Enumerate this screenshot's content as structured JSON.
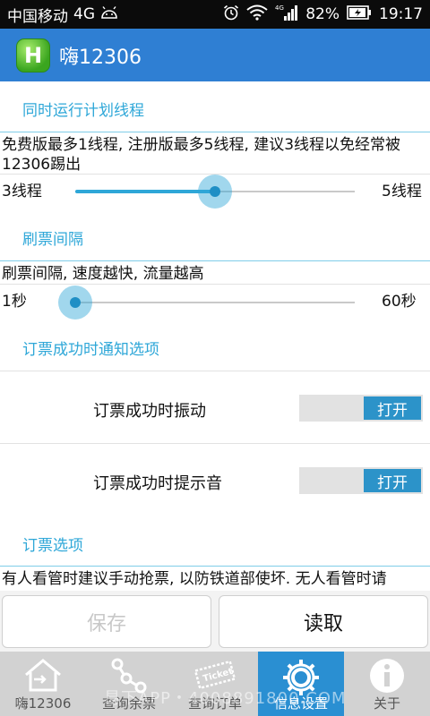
{
  "status_bar": {
    "carrier": "中国移动",
    "network": "4G",
    "battery": "82%",
    "time": "19:17",
    "icons": [
      "android-icon",
      "alarm-icon",
      "wifi-icon",
      "signal-4g-icon",
      "battery-icon"
    ]
  },
  "app_bar": {
    "logo_letter": "H",
    "title": "嗨12306"
  },
  "sections": {
    "threads": {
      "header": "同时运行计划线程",
      "description": "免费版最多1线程, 注册版最多5线程, 建议3线程以免经常被12306踢出",
      "current_label": "3线程",
      "max_label": "5线程",
      "value": 3,
      "min": 1,
      "max": 5
    },
    "interval": {
      "header": "刷票间隔",
      "description": "刷票间隔, 速度越快, 流量越高",
      "current_label": "1秒",
      "max_label": "60秒",
      "value": 1,
      "min": 1,
      "max": 60
    },
    "notify": {
      "header": "订票成功时通知选项",
      "vibrate_label": "订票成功时振动",
      "vibrate_state": "打开",
      "sound_label": "订票成功时提示音",
      "sound_state": "打开"
    },
    "booking": {
      "header": "订票选项",
      "description": "有人看管时建议手动抢票, 以防铁道部使坏. 无人看管时请"
    }
  },
  "buttons": {
    "save": "保存",
    "read": "读取"
  },
  "bottom_nav": [
    {
      "label": "嗨12306",
      "icon": "home-icon",
      "active": false
    },
    {
      "label": "查询余票",
      "icon": "share-nodes-icon",
      "active": false
    },
    {
      "label": "查询订单",
      "icon": "ticket-icon",
      "active": false
    },
    {
      "label": "信息设置",
      "icon": "gear-icon",
      "active": true
    },
    {
      "label": "关于",
      "icon": "info-icon",
      "active": false
    }
  ],
  "ticket_icon_text": "Ticket",
  "watermark": "易下APP・4008891800.COM",
  "colors": {
    "app_bar": "#2f7fd3",
    "accent": "#2ea7d8",
    "nav_active": "#2a8fd2",
    "toggle_on": "#2c93c9"
  }
}
